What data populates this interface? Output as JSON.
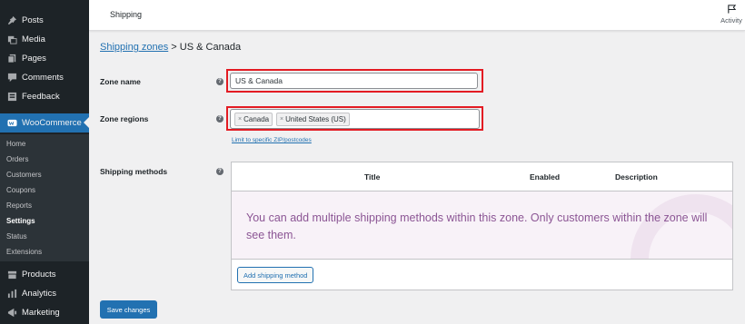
{
  "sidebar": {
    "items_top": [
      {
        "label": "Posts",
        "icon": "pin-icon"
      },
      {
        "label": "Media",
        "icon": "media-icon"
      },
      {
        "label": "Pages",
        "icon": "pages-icon"
      },
      {
        "label": "Comments",
        "icon": "comments-icon"
      },
      {
        "label": "Feedback",
        "icon": "feedback-icon"
      }
    ],
    "woocommerce": {
      "label": "WooCommerce",
      "icon": "woocommerce-icon"
    },
    "submenu": [
      "Home",
      "Orders",
      "Customers",
      "Coupons",
      "Reports",
      "Settings",
      "Status",
      "Extensions"
    ],
    "submenu_current": "Settings",
    "items_bottom": [
      {
        "label": "Products",
        "icon": "products-icon"
      },
      {
        "label": "Analytics",
        "icon": "analytics-icon"
      },
      {
        "label": "Marketing",
        "icon": "marketing-icon"
      }
    ]
  },
  "header": {
    "title": "Shipping",
    "activity_label": "Activity"
  },
  "breadcrumb": {
    "link": "Shipping zones",
    "separator": ">",
    "current": "US & Canada"
  },
  "form": {
    "zone_name_label": "Zone name",
    "zone_name_value": "US & Canada",
    "zone_regions_label": "Zone regions",
    "regions": [
      "Canada",
      "United States (US)"
    ],
    "limit_link": "Limit to specific ZIP/postcodes",
    "shipping_methods_label": "Shipping methods"
  },
  "methods_table": {
    "columns": [
      "Title",
      "Enabled",
      "Description"
    ],
    "empty_message": "You can add multiple shipping methods within this zone. Only customers within the zone will see them.",
    "add_button": "Add shipping method"
  },
  "save_button": "Save changes",
  "colors": {
    "sidebar_bg": "#1d2327",
    "accent": "#2271b1",
    "highlight_box": "#e31b23",
    "empty_state_text": "#8b5594"
  }
}
